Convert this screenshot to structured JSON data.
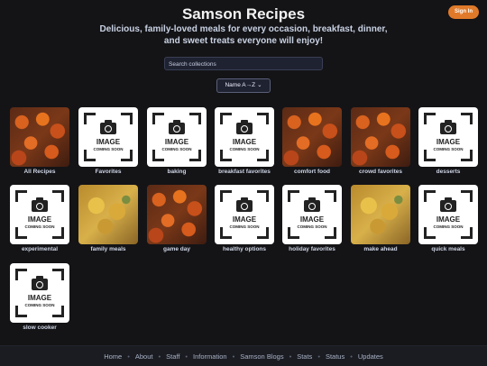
{
  "header": {
    "title": "Samson Recipes",
    "tagline_line1": "Delicious, family-loved meals for every occasion, breakfast, dinner,",
    "tagline_line2": "and sweet treats everyone will enjoy!",
    "signin_label": "Sign In"
  },
  "search": {
    "placeholder": "Search collections"
  },
  "sort": {
    "selected": "Name A→Z"
  },
  "placeholder_image": {
    "line1": "IMAGE",
    "line2": "COMING SOON"
  },
  "collections": [
    {
      "label": "All Recipes",
      "image": "photo"
    },
    {
      "label": "Favorites",
      "image": "placeholder"
    },
    {
      "label": "baking",
      "image": "placeholder"
    },
    {
      "label": "breakfast favorites",
      "image": "placeholder"
    },
    {
      "label": "comfort food",
      "image": "photo"
    },
    {
      "label": "crowd favorites",
      "image": "photo"
    },
    {
      "label": "desserts",
      "image": "placeholder"
    },
    {
      "label": "experimental",
      "image": "placeholder"
    },
    {
      "label": "family meals",
      "image": "photo2"
    },
    {
      "label": "game day",
      "image": "photo"
    },
    {
      "label": "healthy options",
      "image": "placeholder"
    },
    {
      "label": "holiday favorites",
      "image": "placeholder"
    },
    {
      "label": "make ahead",
      "image": "photo2"
    },
    {
      "label": "quick meals",
      "image": "placeholder"
    },
    {
      "label": "slow cooker",
      "image": "placeholder"
    }
  ],
  "footer": {
    "links": [
      "Home",
      "About",
      "Staff",
      "Information",
      "Samson Blogs",
      "Stats",
      "Status",
      "Updates"
    ],
    "separator": "•"
  },
  "colors": {
    "accent": "#e07a2a",
    "background": "#141417"
  }
}
